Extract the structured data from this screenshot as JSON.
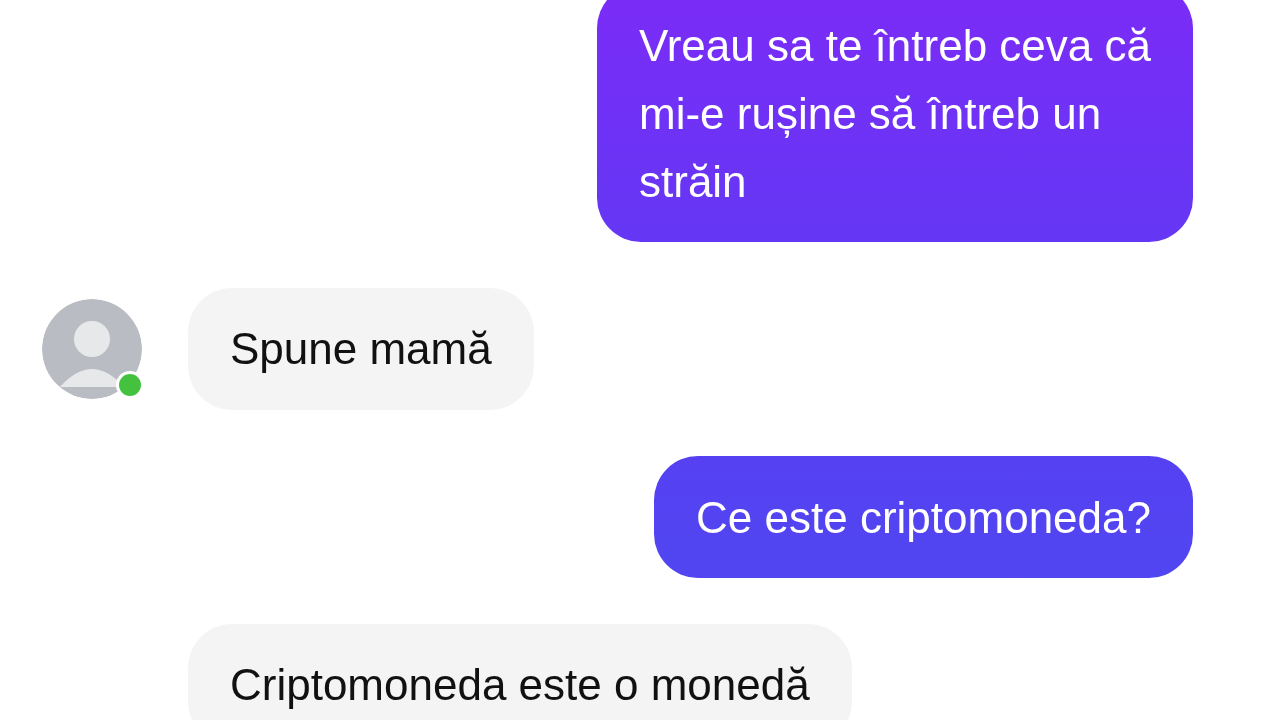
{
  "messages": [
    {
      "kind": "sent",
      "lines": [
        "Vreau sa te întreb ceva că",
        "mi-e rușine să întreb un",
        "străin"
      ]
    },
    {
      "kind": "received",
      "show_avatar": true,
      "online": true,
      "lines": [
        "Spune mamă"
      ]
    },
    {
      "kind": "sent",
      "lines": [
        "Ce este criptomoneda?"
      ]
    },
    {
      "kind": "received",
      "show_avatar": false,
      "lines": [
        "Criptomoneda este o monedă"
      ]
    }
  ]
}
